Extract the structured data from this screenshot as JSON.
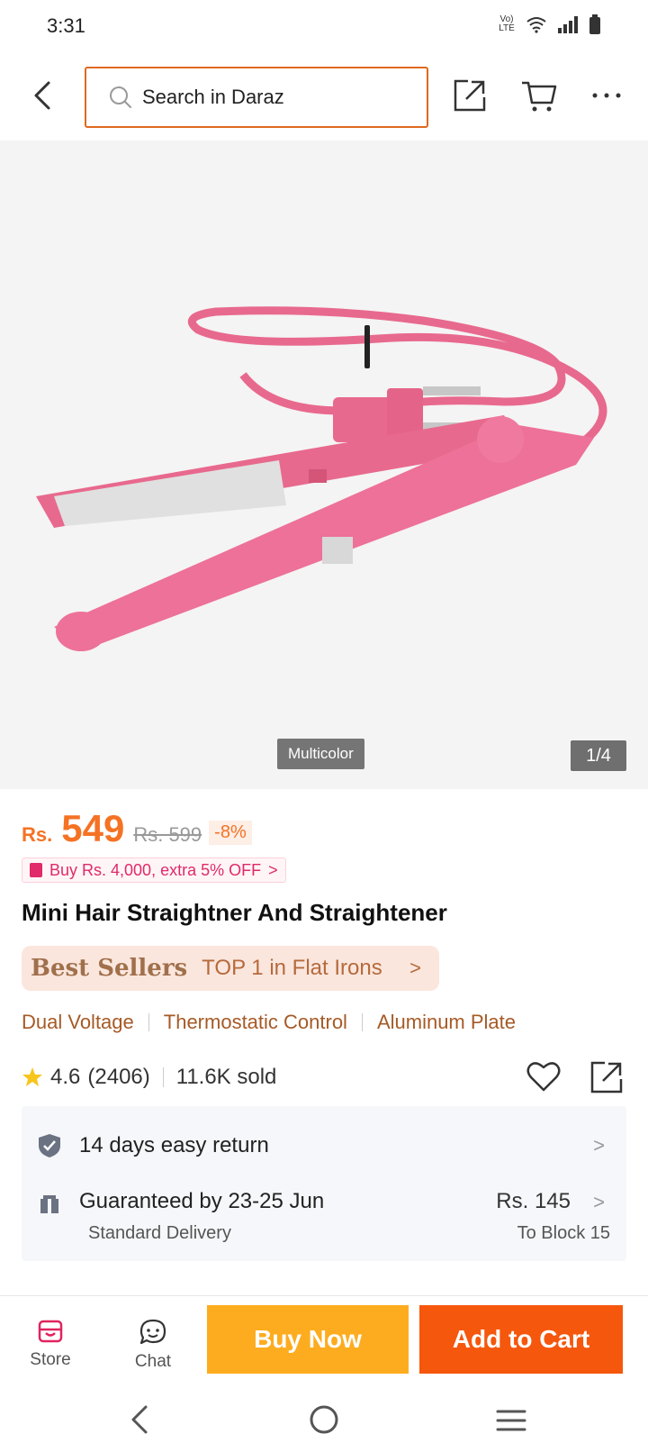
{
  "status": {
    "time": "3:31",
    "network_label": "Vo) LTE"
  },
  "search": {
    "placeholder": "Search in Daraz"
  },
  "gallery": {
    "variant": "Multicolor",
    "counter": "1/4"
  },
  "product": {
    "currency": "Rs.",
    "price": "549",
    "old_price": "Rs. 599",
    "discount": "-8%",
    "promo": "Buy Rs. 4,000, extra 5% OFF",
    "promo_arrow": ">",
    "title": "Mini Hair Straightner And Straightener",
    "bestseller_label": "Best Sellers",
    "bestseller_text": "TOP 1 in Flat Irons",
    "bestseller_arrow": ">",
    "features": [
      "Dual Voltage",
      "Thermostatic Control",
      "Aluminum Plate"
    ],
    "rating": "4.6",
    "reviews": "(2406)",
    "sold": "11.6K sold"
  },
  "service": {
    "return": "14 days easy return",
    "delivery_title": "Guaranteed by 23-25 Jun",
    "delivery_type": "Standard Delivery",
    "delivery_fee": "Rs. 145",
    "delivery_dest": "To Block 15",
    "chevron": ">"
  },
  "actions": {
    "store": "Store",
    "chat": "Chat",
    "buy_now": "Buy Now",
    "add_to_cart": "Add to Cart"
  },
  "colors": {
    "accent": "#f57224",
    "buy_now": "#fdac1f",
    "add_to_cart": "#f5570d",
    "product_pink": "#e8698e"
  }
}
